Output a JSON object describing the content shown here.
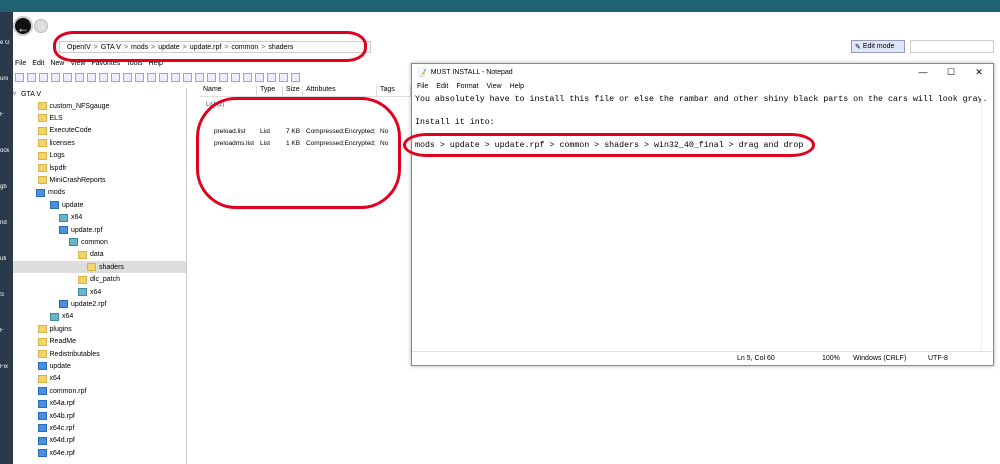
{
  "desktop": {
    "labels": [
      "GAMES",
      "e G",
      "uni",
      "F",
      "ock",
      "gb",
      "nd",
      "uti",
      "S",
      "F",
      "Fix"
    ]
  },
  "address_bar": {
    "crumbs": [
      "OpenIV",
      "GTA V",
      "mods",
      "update",
      "update.rpf",
      "common",
      "shaders"
    ],
    "separator": ">"
  },
  "edit_mode_label": "Edit mode",
  "menu": [
    "File",
    "Edit",
    "New",
    "View",
    "Favorites",
    "Tools",
    "Help"
  ],
  "tree": {
    "root": "GTA V",
    "items": [
      {
        "label": "custom_NFSgauge",
        "icon": "y"
      },
      {
        "label": "ELS",
        "icon": "y"
      },
      {
        "label": "ExecuteCode",
        "icon": "y"
      },
      {
        "label": "licenses",
        "icon": "y"
      },
      {
        "label": "Logs",
        "icon": "y"
      },
      {
        "label": "lspdfr",
        "icon": "y"
      },
      {
        "label": "MiniCrashReports",
        "icon": "y"
      },
      {
        "label": "mods",
        "icon": "b"
      },
      {
        "label": "update",
        "icon": "b"
      },
      {
        "label": "x64",
        "icon": "t"
      },
      {
        "label": "update.rpf",
        "icon": "b"
      },
      {
        "label": "common",
        "icon": "t"
      },
      {
        "label": "data",
        "icon": "y"
      },
      {
        "label": "shaders",
        "icon": "y"
      },
      {
        "label": "dlc_patch",
        "icon": "y"
      },
      {
        "label": "x64",
        "icon": "t"
      },
      {
        "label": "update2.rpf",
        "icon": "b"
      },
      {
        "label": "x64",
        "icon": "t"
      },
      {
        "label": "plugins",
        "icon": "y"
      },
      {
        "label": "ReadMe",
        "icon": "y"
      },
      {
        "label": "Redistributables",
        "icon": "y"
      },
      {
        "label": "update",
        "icon": "b"
      },
      {
        "label": "x64",
        "icon": "y"
      },
      {
        "label": "common.rpf",
        "icon": "b"
      },
      {
        "label": "x64a.rpf",
        "icon": "b"
      },
      {
        "label": "x64b.rpf",
        "icon": "b"
      },
      {
        "label": "x64c.rpf",
        "icon": "b"
      },
      {
        "label": "x64d.rpf",
        "icon": "b"
      },
      {
        "label": "x64e.rpf",
        "icon": "b"
      }
    ]
  },
  "list": {
    "columns": [
      "Name",
      "Type",
      "Size",
      "Attributes",
      "Tags"
    ],
    "group": "List (2)",
    "rows": [
      [
        "preload.list",
        "List",
        "7 KB",
        "Compressed;Encrypted;",
        "No"
      ],
      [
        "preloadms.list",
        "List",
        "1 KB",
        "Compressed;Encrypted;",
        "No"
      ]
    ]
  },
  "notepad": {
    "title": "MUST INSTALL - Notepad",
    "controls": [
      "—",
      "☐",
      "✕"
    ],
    "menu": [
      "File",
      "Edit",
      "Format",
      "View",
      "Help"
    ],
    "lines": [
      "You absolutely have to install this file or else the rambar and other shiny black parts on the cars will look gray.",
      "",
      "Install it into:",
      "",
      "mods > update > update.rpf > common > shaders > win32_40_final > drag and drop"
    ],
    "status": {
      "pos": "Ln 5, Col 60",
      "zoom": "100%",
      "eol": "Windows (CRLF)",
      "enc": "UTF-8"
    }
  },
  "annotation_color": "#e1001e"
}
